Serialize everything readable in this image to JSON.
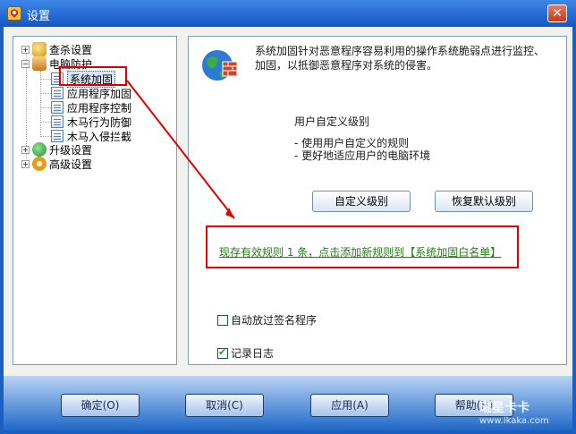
{
  "window": {
    "title": "设置",
    "close_glyph": "✕"
  },
  "tree": {
    "items": [
      {
        "label": "查杀设置",
        "icon": "search-shield-icon"
      },
      {
        "label": "电脑防护",
        "icon": "shield-icon"
      },
      {
        "label": "系统加固",
        "icon": "page-icon"
      },
      {
        "label": "应用程序加固",
        "icon": "page-icon"
      },
      {
        "label": "应用程序控制",
        "icon": "page-icon"
      },
      {
        "label": "木马行为防御",
        "icon": "page-icon"
      },
      {
        "label": "木马入侵拦截",
        "icon": "page-icon"
      },
      {
        "label": "升级设置",
        "icon": "check-globe-icon"
      },
      {
        "label": "高级设置",
        "icon": "gear-icon"
      }
    ],
    "expander_plus": "+",
    "expander_minus": "−"
  },
  "panel": {
    "description": "系统加固针对恶意程序容易利用的操作系统脆弱点进行监控、加固，以抵御恶意程序对系统的侵害。",
    "level_title": "用户自定义级别",
    "level_bullets": [
      "- 使用用户自定义的规则",
      "- 更好地适应用户的电脑环境"
    ],
    "custom_button": "自定义级别",
    "restore_button": "恢复默认级别",
    "rule_link": "现存有效规则 1 条，点击添加新规则到【系统加固白名单】",
    "auto_release": {
      "label": "自动放过签名程序",
      "checked": false
    },
    "log": {
      "label": "记录日志",
      "checked": true
    }
  },
  "footer": {
    "ok": "确定(O)",
    "cancel": "取消(C)",
    "apply": "应用(A)",
    "help": "帮助(H)"
  },
  "watermark": {
    "brand": "瑞星卡卡",
    "url": "www.ikaka.com"
  },
  "colors": {
    "title_bar": "#1c5fc0",
    "annotation": "#e00000",
    "link_green": "#2a7a1c"
  }
}
